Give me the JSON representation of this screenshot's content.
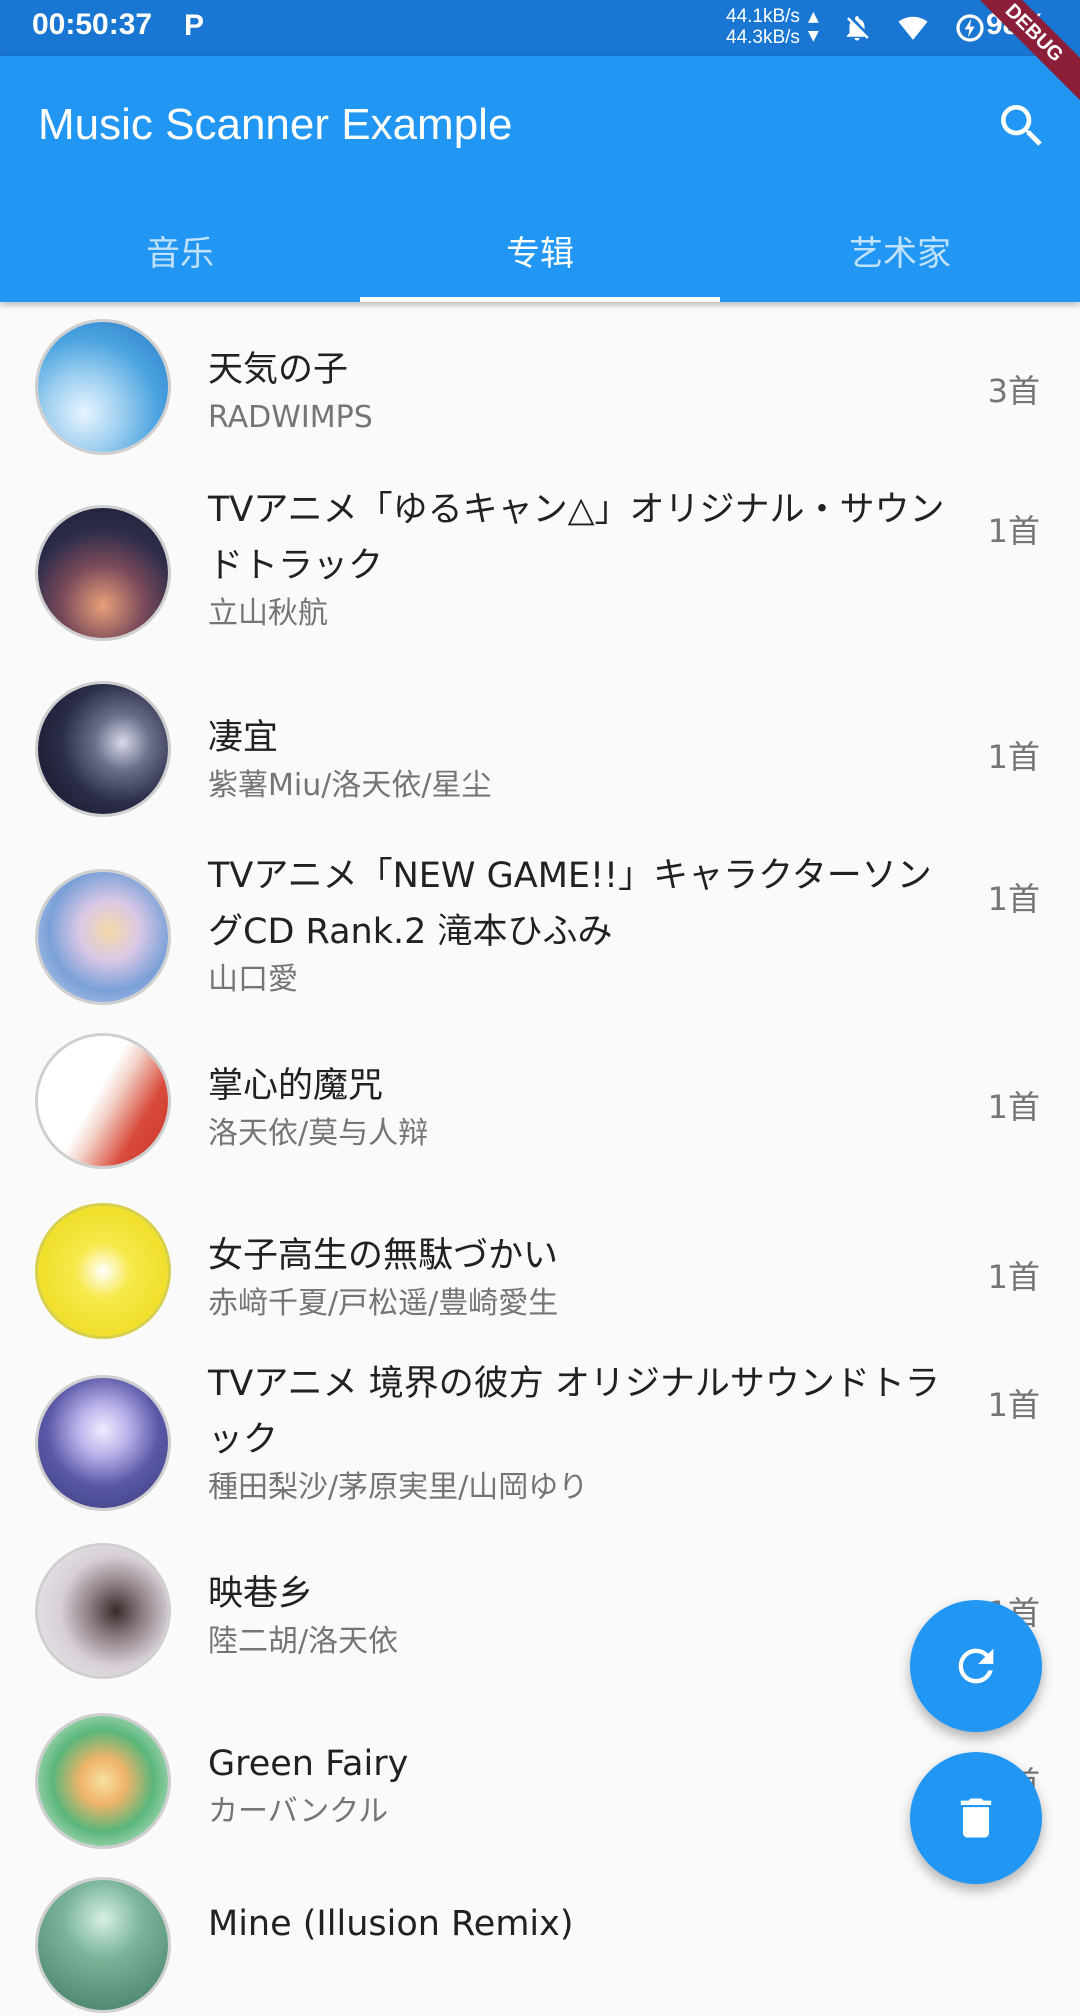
{
  "status_bar": {
    "time": "00:50:37",
    "p_icon": "P",
    "speed_up": "44.1kB/s",
    "speed_down": "44.3kB/s",
    "battery": "98%",
    "icons": [
      "notifications-off-icon",
      "wifi-icon",
      "battery-saver-icon"
    ]
  },
  "app_bar": {
    "title": "Music Scanner Example",
    "debug_banner": "DEBUG",
    "search_icon": "search-icon"
  },
  "tabs": [
    {
      "label": "音乐",
      "active": false
    },
    {
      "label": "专辑",
      "active": true
    },
    {
      "label": "艺术家",
      "active": false
    }
  ],
  "albums": [
    {
      "title": "天気の子",
      "artist": "RADWIMPS",
      "count": "3首"
    },
    {
      "title": "TVアニメ「ゆるキャン△」オリジナル・サウンドトラック",
      "artist": "立山秋航",
      "count": "1首"
    },
    {
      "title": "凄宜",
      "artist": "紫薯Miu/洛天依/星尘",
      "count": "1首"
    },
    {
      "title": "TVアニメ「NEW GAME!!」キャラクターソングCD Rank.2 滝本ひふみ",
      "artist": "山口愛",
      "count": "1首"
    },
    {
      "title": "掌心的魔咒",
      "artist": "洛天依/莫与人辩",
      "count": "1首"
    },
    {
      "title": "女子高生の無駄づかい",
      "artist": "赤﨑千夏/戸松遥/豊崎愛生",
      "count": "1首"
    },
    {
      "title": "TVアニメ 境界の彼方 オリジナルサウンドトラック",
      "artist": "種田梨沙/茅原実里/山岡ゆり",
      "count": "1首"
    },
    {
      "title": "映巷乡",
      "artist": "陸二胡/洛天依",
      "count": "1首"
    },
    {
      "title": "Green Fairy",
      "artist": "カーバンクル",
      "count": "1首"
    },
    {
      "title": "Mine (Illusion Remix)",
      "artist": "",
      "count": ""
    }
  ],
  "fabs": {
    "refresh_icon": "refresh-icon",
    "delete_icon": "delete-icon"
  },
  "colors": {
    "primary": "#2196f3",
    "status_bar": "#1976d2",
    "debug_banner": "#8b1f3a"
  }
}
